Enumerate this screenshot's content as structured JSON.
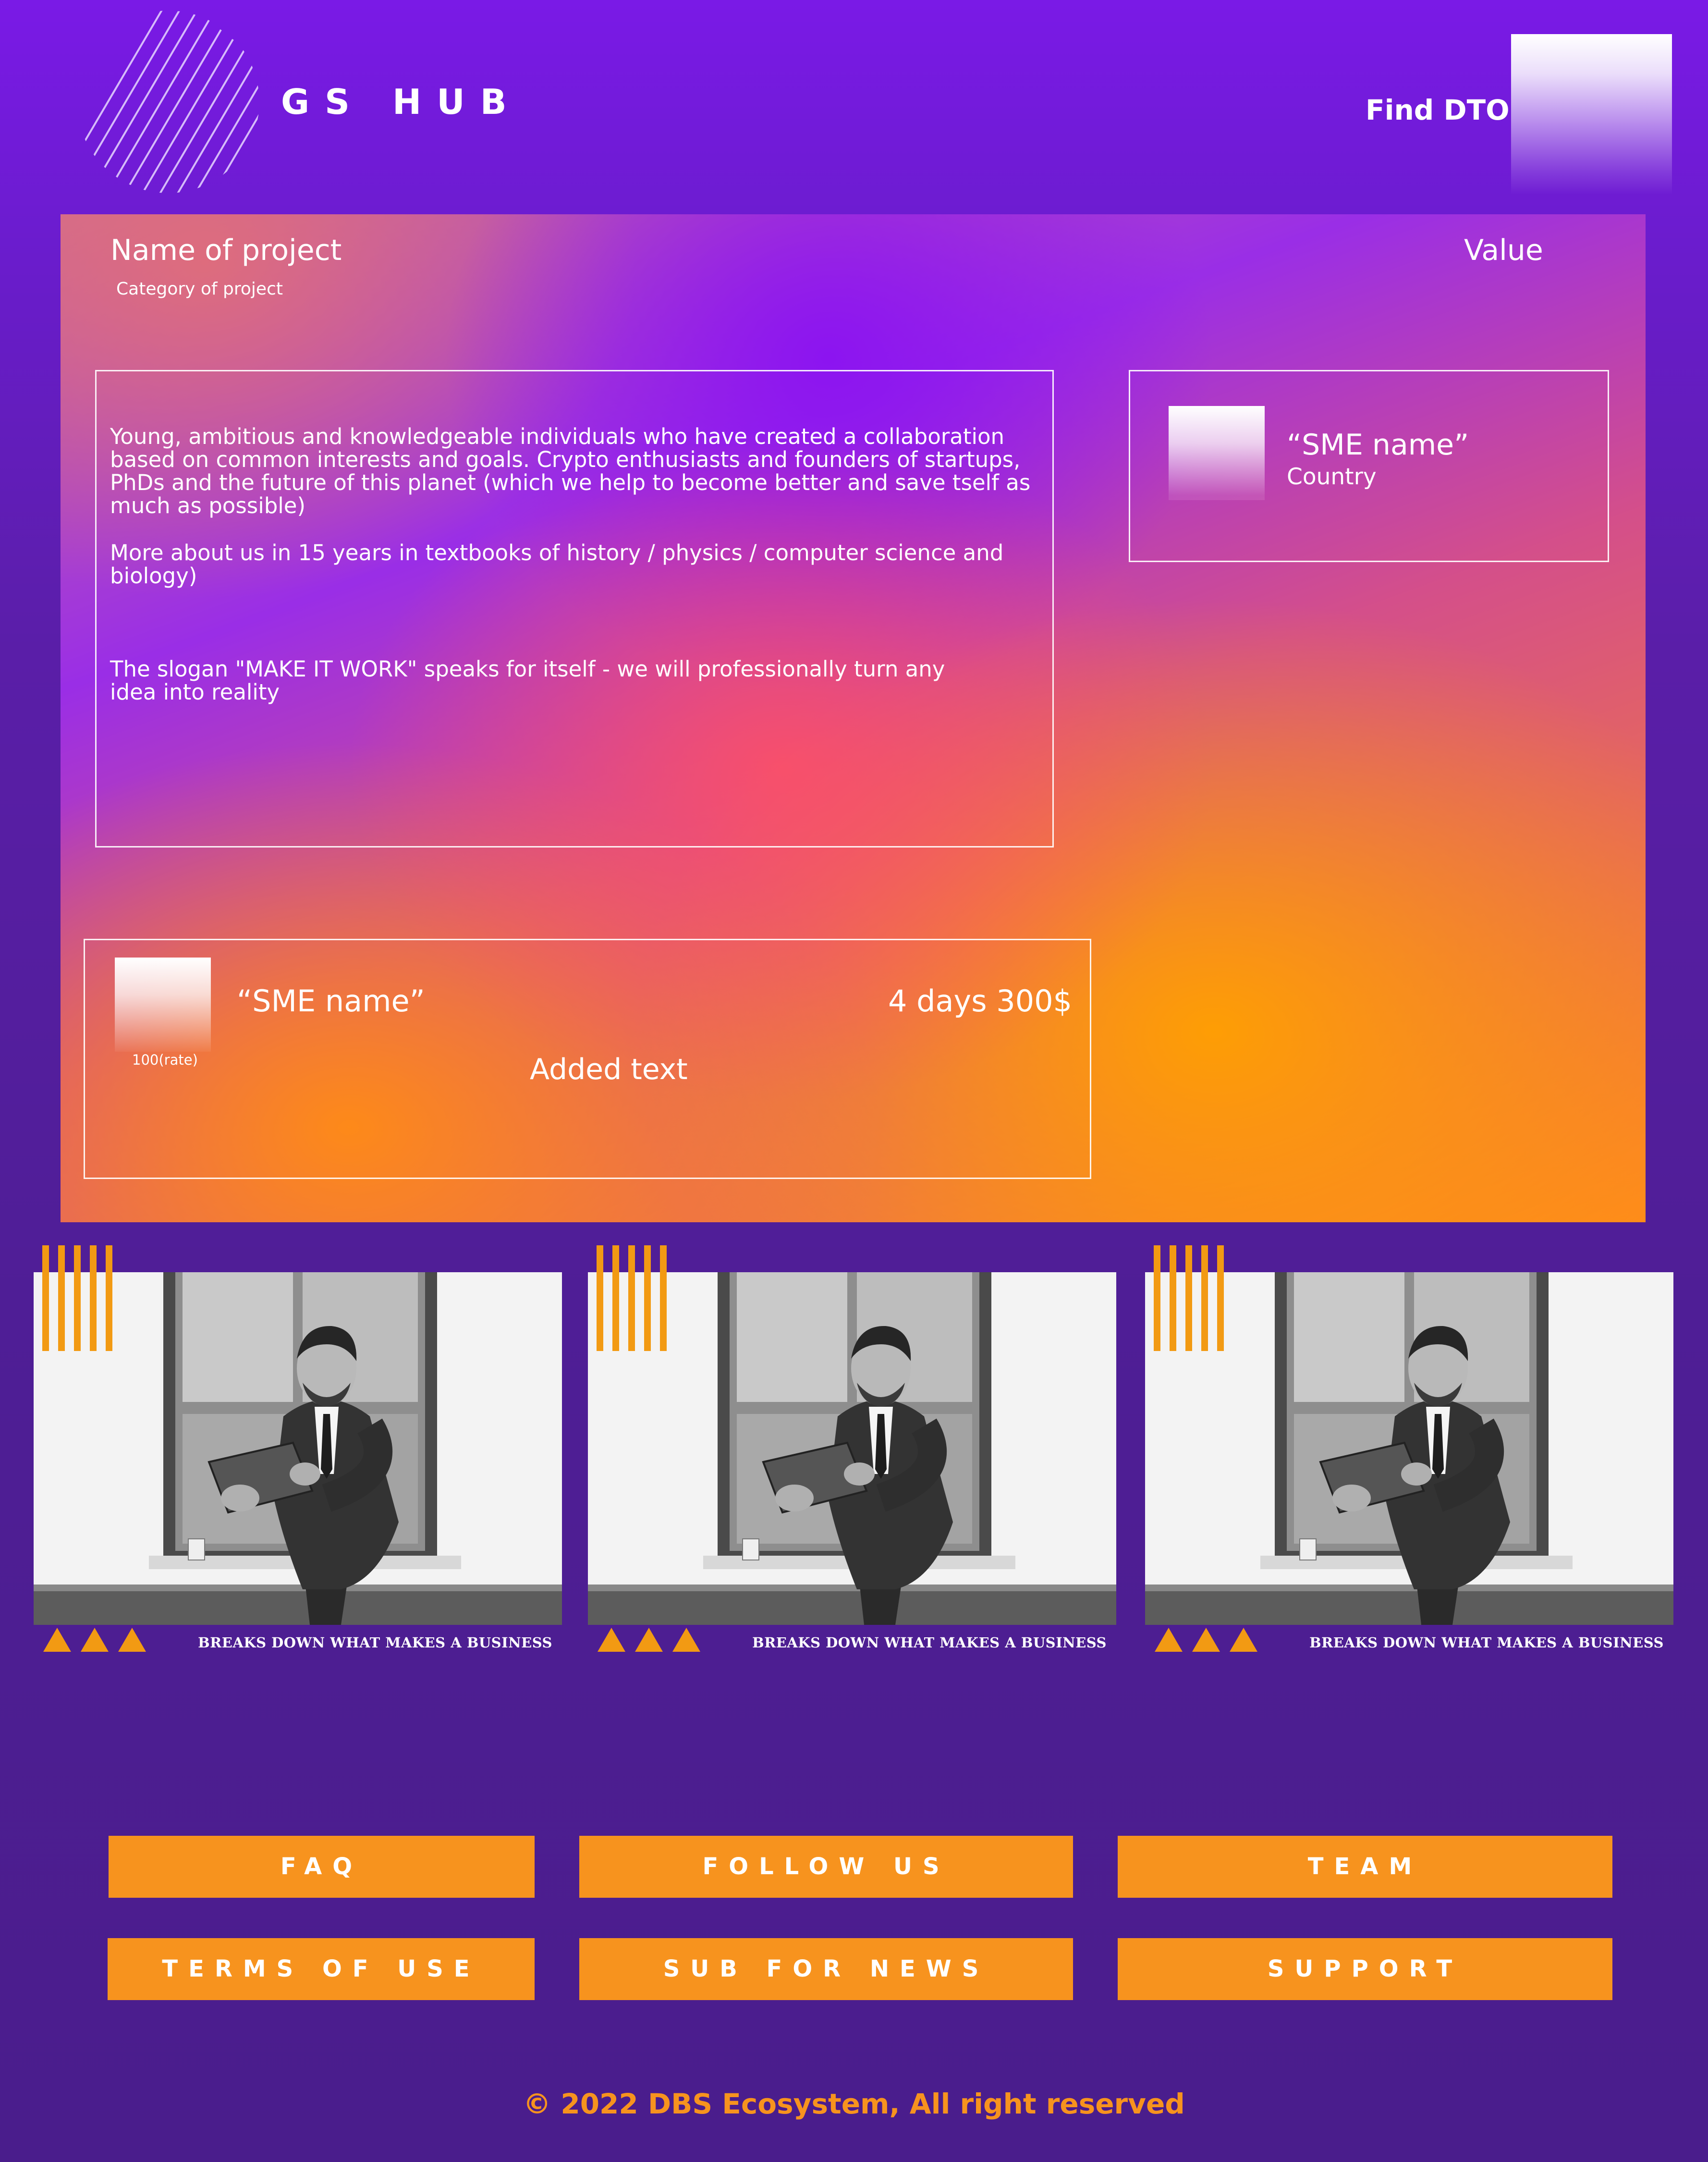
{
  "header": {
    "brand": "GS HUB",
    "find_label": "Find DTO"
  },
  "project": {
    "title": "Name of project",
    "category": "Category of project",
    "value_label": "Value",
    "description": [
      "Young, ambitious and knowledgeable individuals who have created a collaboration based on common interests and goals. Crypto enthusiasts and founders of startups, PhDs and the future of this planet (which we help to become better and save tself as much as possible)",
      "More  about us in 15 years in textbooks of history / physics / computer science and biology)",
      "The slogan \"MAKE IT WORK\" speaks for itself - we will professionally turn any idea into reality"
    ],
    "sme": {
      "name": "“SME name”",
      "country": "Country"
    },
    "offer": {
      "sme_name": "“SME name”",
      "rate": "100(rate)",
      "price": "4 days 300$",
      "added_text": "Added text"
    }
  },
  "cards": [
    {
      "caption": "BREAKS DOWN WHAT MAKES A BUSINESS"
    },
    {
      "caption": "BREAKS DOWN WHAT MAKES A BUSINESS"
    },
    {
      "caption": "BREAKS DOWN WHAT MAKES A BUSINESS"
    }
  ],
  "footer": {
    "buttons": [
      "FAQ",
      "FOLLOW US",
      "TEAM",
      "TERMS OF USE",
      "SUB FOR NEWS",
      "SUPPORT"
    ],
    "copyright": "© 2022 DBS Ecosystem, All right reserved"
  },
  "colors": {
    "accent": "#f7931e",
    "background": "#5a1ea8",
    "panel_purple": "#8a14f0",
    "panel_orange": "#ffa000"
  },
  "icons": [
    "logo-stripes-icon",
    "triangle-icon",
    "stripes-decoration-icon"
  ]
}
